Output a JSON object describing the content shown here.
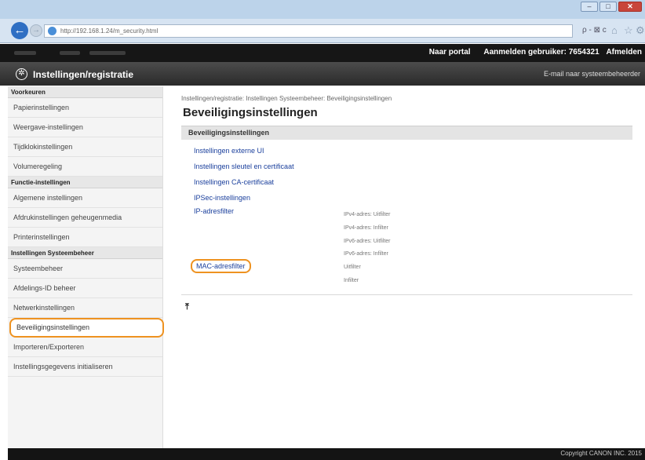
{
  "browser": {
    "url": "http://192.168.1.24/m_security.html",
    "search_tools": "ρ - ⊠ c"
  },
  "topbar": {
    "portal_link": "Naar portal",
    "login_user": "Aanmelden gebruiker: 7654321",
    "logout_link": "Afmelden"
  },
  "header": {
    "title": "Instellingen/registratie",
    "admin_mail": "E-mail naar systeembeheerder"
  },
  "sidebar": {
    "section1": "Voorkeuren",
    "items1": [
      "Papierinstellingen",
      "Weergave-instellingen",
      "Tijdklokinstellingen",
      "Volumeregeling"
    ],
    "section2": "Functie-instellingen",
    "items2": [
      "Algemene instellingen",
      "Afdrukinstellingen geheugenmedia",
      "Printerinstellingen"
    ],
    "section3": "Instellingen Systeembeheer",
    "items3": [
      "Systeembeheer",
      "Afdelings-ID beheer",
      "Netwerkinstellingen",
      "Beveiligingsinstellingen",
      "Importeren/Exporteren",
      "Instellingsgegevens initialiseren"
    ]
  },
  "main": {
    "breadcrumb": "Instellingen/registratie: Instellingen Systeembeheer: Beveiligingsinstellingen",
    "title": "Beveiligingsinstellingen",
    "section_head": "Beveiligingsinstellingen",
    "links": [
      "Instellingen externe UI",
      "Instellingen sleutel en certificaat",
      "Instellingen CA-certificaat",
      "IPSec-instellingen",
      "IP-adresfilter",
      "MAC-adresfilter"
    ],
    "ip_filter_status": [
      "IPv4-adres: Uitfilter",
      "IPv4-adres: Infilter",
      "IPv6-adres: Uitfilter",
      "IPv6-adres: Infilter"
    ],
    "mac_filter_status": [
      "Uitfilter",
      "Infilter"
    ]
  },
  "footer": {
    "copyright": "Copyright CANON INC. 2015"
  }
}
